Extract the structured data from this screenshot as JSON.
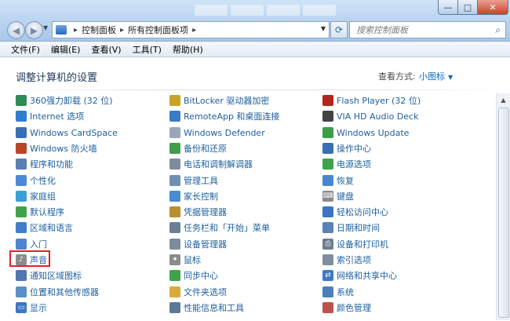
{
  "window": {
    "minimize_glyph": "—",
    "maximize_glyph": "□",
    "close_glyph": "✕"
  },
  "nav": {
    "back_glyph": "◀",
    "forward_glyph": "▶",
    "breadcrumb": [
      "控制面板",
      "所有控制面板项"
    ],
    "search_placeholder": "搜索控制面板",
    "refresh_glyph": "⟳",
    "search_glyph": "⌕"
  },
  "menu": [
    "文件(F)",
    "编辑(E)",
    "查看(V)",
    "工具(T)",
    "帮助(H)"
  ],
  "page": {
    "title": "调整计算机的设置",
    "view_by_label": "查看方式:",
    "view_mode": "小图标"
  },
  "items": {
    "col1": [
      {
        "label": "360强力卸载 (32 位)",
        "icon": "uninstall-icon",
        "color": "#2e8b57"
      },
      {
        "label": "Internet 选项",
        "icon": "internet-options-icon",
        "color": "#2f7dd1"
      },
      {
        "label": "Windows CardSpace",
        "icon": "cardspace-icon",
        "color": "#3a6fb5"
      },
      {
        "label": "Windows 防火墙",
        "icon": "firewall-icon",
        "color": "#b9452c"
      },
      {
        "label": "程序和功能",
        "icon": "programs-icon",
        "color": "#5a7fb0"
      },
      {
        "label": "个性化",
        "icon": "personalization-icon",
        "color": "#4b8ad8"
      },
      {
        "label": "家庭组",
        "icon": "homegroup-icon",
        "color": "#3aa0d8"
      },
      {
        "label": "默认程序",
        "icon": "default-programs-icon",
        "color": "#3fa34d"
      },
      {
        "label": "区域和语言",
        "icon": "region-icon",
        "color": "#3f7fc9"
      },
      {
        "label": "入门",
        "icon": "getting-started-icon",
        "color": "#4a86cf"
      },
      {
        "label": "声音",
        "icon": "sound-icon",
        "color": "#8d8d8d"
      },
      {
        "label": "通知区域图标",
        "icon": "notification-icon",
        "color": "#4f77b0"
      },
      {
        "label": "位置和其他传感器",
        "icon": "sensor-icon",
        "color": "#5a8fc9"
      },
      {
        "label": "显示",
        "icon": "display-icon",
        "color": "#3e77c3"
      }
    ],
    "col2": [
      {
        "label": "BitLocker 驱动器加密",
        "icon": "bitlocker-icon",
        "color": "#c9a227"
      },
      {
        "label": "RemoteApp 和桌面连接",
        "icon": "remoteapp-icon",
        "color": "#3b7cc6"
      },
      {
        "label": "Windows Defender",
        "icon": "defender-icon",
        "color": "#9aa7b6"
      },
      {
        "label": "备份和还原",
        "icon": "backup-icon",
        "color": "#3f9e4c"
      },
      {
        "label": "电话和调制解调器",
        "icon": "modem-icon",
        "color": "#7c8c9c"
      },
      {
        "label": "管理工具",
        "icon": "admin-tools-icon",
        "color": "#6f8fb0"
      },
      {
        "label": "家长控制",
        "icon": "parental-control-icon",
        "color": "#4a8bd1"
      },
      {
        "label": "凭据管理器",
        "icon": "credential-icon",
        "color": "#b8902e"
      },
      {
        "label": "任务栏和「开始」菜单",
        "icon": "taskbar-icon",
        "color": "#6b7f95"
      },
      {
        "label": "设备管理器",
        "icon": "device-manager-icon",
        "color": "#7d8d9d"
      },
      {
        "label": "鼠标",
        "icon": "mouse-icon",
        "color": "#8b8b8b"
      },
      {
        "label": "同步中心",
        "icon": "sync-icon",
        "color": "#3fa34d"
      },
      {
        "label": "文件夹选项",
        "icon": "folder-options-icon",
        "color": "#d9a93a"
      },
      {
        "label": "性能信息和工具",
        "icon": "performance-icon",
        "color": "#5d7896"
      }
    ],
    "col3": [
      {
        "label": "Flash Player (32 位)",
        "icon": "flash-icon",
        "color": "#b3241b"
      },
      {
        "label": "VIA HD Audio Deck",
        "icon": "audio-deck-icon",
        "color": "#444444"
      },
      {
        "label": "Windows Update",
        "icon": "windows-update-icon",
        "color": "#3a9f48"
      },
      {
        "label": "操作中心",
        "icon": "action-center-icon",
        "color": "#3a6fb5"
      },
      {
        "label": "电源选项",
        "icon": "power-icon",
        "color": "#3fa34d"
      },
      {
        "label": "恢复",
        "icon": "recovery-icon",
        "color": "#4a86cf"
      },
      {
        "label": "键盘",
        "icon": "keyboard-icon",
        "color": "#8a8a8a"
      },
      {
        "label": "轻松访问中心",
        "icon": "ease-of-access-icon",
        "color": "#3a74c2"
      },
      {
        "label": "日期和时间",
        "icon": "datetime-icon",
        "color": "#5a82b4"
      },
      {
        "label": "设备和打印机",
        "icon": "printer-icon",
        "color": "#6c7d90"
      },
      {
        "label": "索引选项",
        "icon": "indexing-icon",
        "color": "#7e8ea0"
      },
      {
        "label": "网络和共享中心",
        "icon": "network-icon",
        "color": "#3c7ac4"
      },
      {
        "label": "系统",
        "icon": "system-icon",
        "color": "#4d7eb9"
      },
      {
        "label": "颜色管理",
        "icon": "color-management-icon",
        "color": "#c0504d"
      }
    ]
  }
}
